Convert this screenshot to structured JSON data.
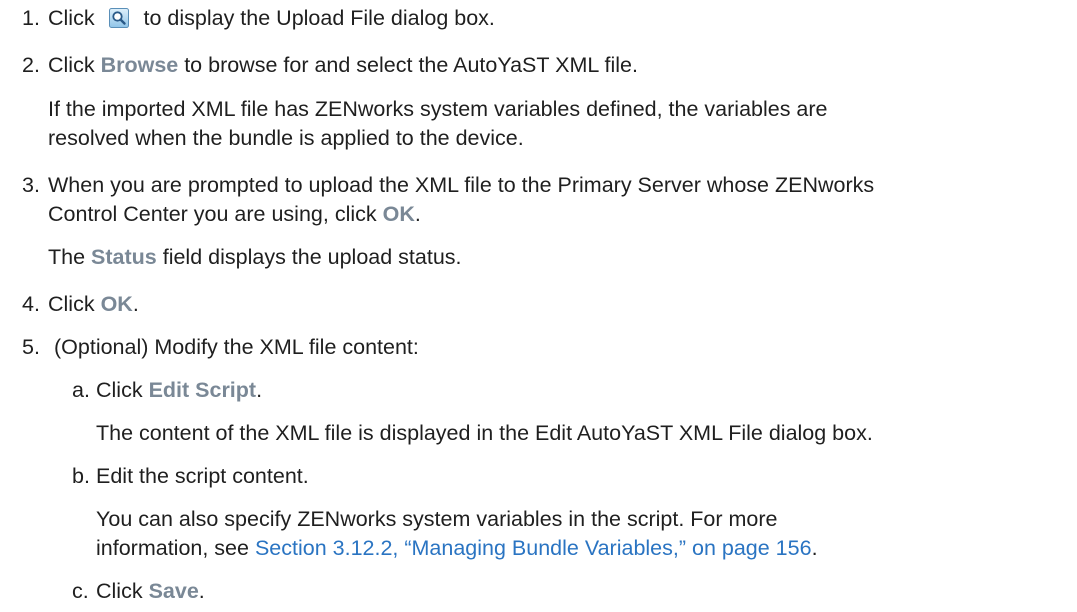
{
  "steps": [
    {
      "num": "1.",
      "pre": "Click",
      "post": "to display the Upload File dialog box.",
      "icon": "search-icon"
    },
    {
      "num": "2.",
      "pre": "Click ",
      "ui": "Browse",
      "post": " to browse for and select the AutoYaST XML file."
    },
    {
      "note_1": "If the imported XML file has ZENworks system variables defined, the variables are",
      "note_2": "resolved when the bundle is applied to the device."
    },
    {
      "num": "3.",
      "line_1": "When you are prompted to upload the XML file to the Primary Server whose ZENworks",
      "line_2_pre": "Control Center you are using, click ",
      "ui": "OK",
      "line_2_post": "."
    },
    {
      "note_pre": "The ",
      "note_ui": "Status",
      "note_post": " field displays the upload status."
    },
    {
      "num": "4.",
      "pre": "Click ",
      "ui": "OK",
      "post": "."
    },
    {
      "num": "5.",
      "text": "(Optional) Modify the XML file content:"
    }
  ],
  "substeps": [
    {
      "letter": "a.",
      "pre": "Click ",
      "ui": "Edit Script",
      "post": ".",
      "note": "The content of the XML file is displayed in the Edit AutoYaST XML File dialog box."
    },
    {
      "letter": "b.",
      "text": "Edit the script content.",
      "note_1": "You can also specify ZENworks system variables in the script. For more",
      "note_2_pre": "information, see ",
      "link": "Section 3.12.2, “Managing Bundle Variables,” on page 156",
      "note_2_post": "."
    },
    {
      "letter": "c.",
      "pre": "Click ",
      "ui": "Save",
      "post": "."
    }
  ],
  "colors": {
    "ui_label": "#7a8896",
    "link": "#2a74c2",
    "text": "#1f1f1f"
  }
}
